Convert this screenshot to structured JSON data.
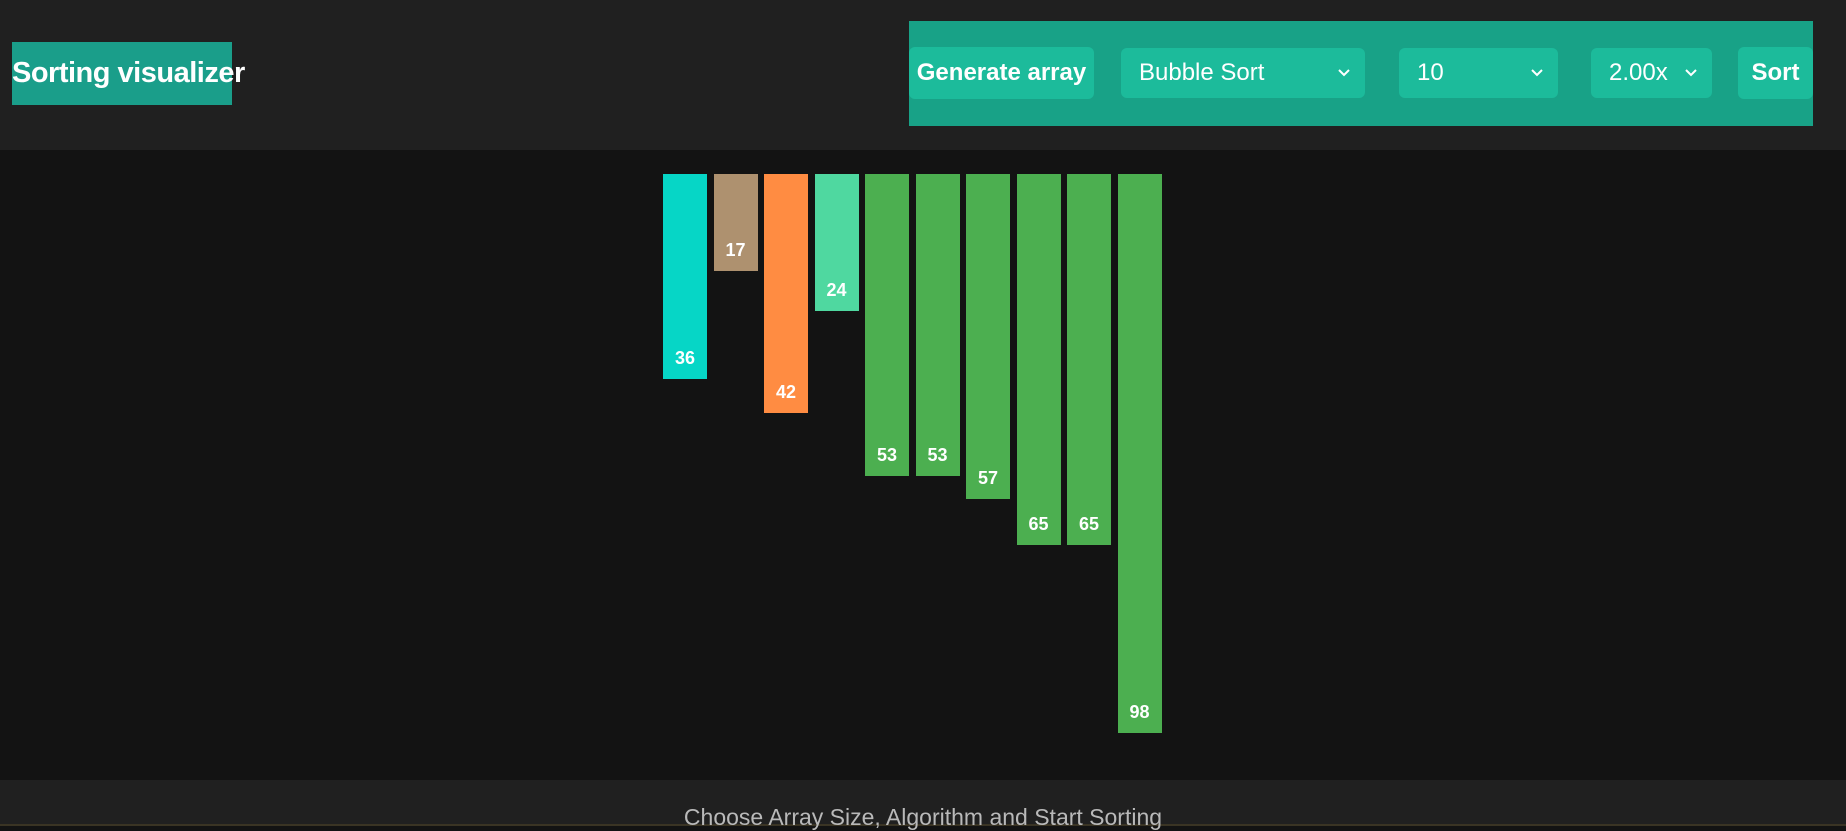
{
  "header": {
    "title": "Sorting visualizer",
    "generate_label": "Generate array",
    "algorithm": {
      "selected": "Bubble Sort",
      "icon": "chevron-down-icon"
    },
    "size": {
      "selected": "10",
      "icon": "chevron-down-icon"
    },
    "speed": {
      "selected": "2.00x",
      "icon": "chevron-down-icon"
    },
    "sort_label": "Sort"
  },
  "bars": [
    {
      "value": 36,
      "color": "#06d6c6"
    },
    {
      "value": 17,
      "color": "#ae916f"
    },
    {
      "value": 42,
      "color": "#ff8c42"
    },
    {
      "value": 24,
      "color": "#4fd8a0"
    },
    {
      "value": 53,
      "color": "#4caf50"
    },
    {
      "value": 53,
      "color": "#4caf50"
    },
    {
      "value": 57,
      "color": "#4caf50"
    },
    {
      "value": 65,
      "color": "#4caf50"
    },
    {
      "value": 65,
      "color": "#4caf50"
    },
    {
      "value": 98,
      "color": "#4caf50"
    }
  ],
  "footer": {
    "text": "Choose Array Size, Algorithm and Start Sorting"
  }
}
